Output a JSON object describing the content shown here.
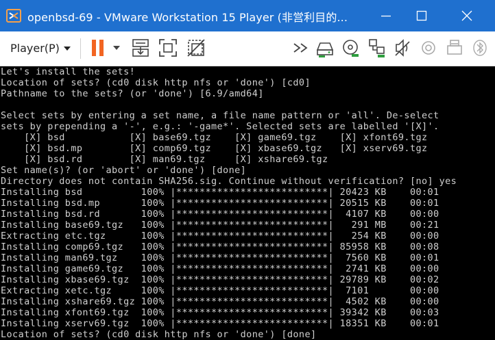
{
  "window": {
    "title": "openbsd-69 - VMware Workstation 15 Player (非営利目的..."
  },
  "toolbar": {
    "player_menu_label": "Player(P)",
    "icons": [
      "pause-icon",
      "dropdown-caret-icon",
      "send-ctrl-alt-del-icon",
      "fullscreen-icon",
      "unity-icon",
      "more-devices-icon",
      "hard-disk-icon",
      "cd-dvd-icon",
      "network-adapter-icon",
      "usb-controller-icon",
      "sound-card-icon",
      "printer-icon",
      "usb-device-icon",
      "bluetooth-icon"
    ]
  },
  "colors": {
    "titlebar": "#1f70cf",
    "accent_orange": "#f26522",
    "terminal_text": "#d0d0d0",
    "terminal_bg": "#000000"
  },
  "terminal": {
    "lines": [
      "Let's install the sets!",
      "Location of sets? (cd0 disk http nfs or 'done') [cd0]",
      "Pathname to the sets? (or 'done') [6.9/amd64]",
      "",
      "Select sets by entering a set name, a file name pattern or 'all'. De-select",
      "sets by prepending a '-', e.g.: '-game*'. Selected sets are labelled '[X]'.",
      "    [X] bsd           [X] base69.tgz    [X] game69.tgz    [X] xfont69.tgz",
      "    [X] bsd.mp        [X] comp69.tgz    [X] xbase69.tgz   [X] xserv69.tgz",
      "    [X] bsd.rd        [X] man69.tgz     [X] xshare69.tgz",
      "Set name(s)? (or 'abort' or 'done') [done]",
      "Directory does not contain SHA256.sig. Continue without verification? [no] yes",
      "Installing bsd          100% |**************************| 20423 KB    00:01",
      "Installing bsd.mp       100% |**************************| 20515 KB    00:01",
      "Installing bsd.rd       100% |**************************|  4107 KB    00:00",
      "Installing base69.tgz   100% |**************************|   291 MB    00:21",
      "Extracting etc.tgz      100% |**************************|   254 KB    00:00",
      "Installing comp69.tgz   100% |**************************| 85958 KB    00:08",
      "Installing man69.tgz    100% |**************************|  7560 KB    00:01",
      "Installing game69.tgz   100% |**************************|  2741 KB    00:00",
      "Installing xbase69.tgz  100% |**************************| 29789 KB    00:02",
      "Extracting xetc.tgz     100% |**************************|  7101       00:00",
      "Installing xshare69.tgz 100% |**************************|  4502 KB    00:00",
      "Installing xfont69.tgz  100% |**************************| 39342 KB    00:03",
      "Installing xserv69.tgz  100% |**************************| 18351 KB    00:01",
      "Location of sets? (cd0 disk http nfs or 'done') [done]"
    ]
  }
}
